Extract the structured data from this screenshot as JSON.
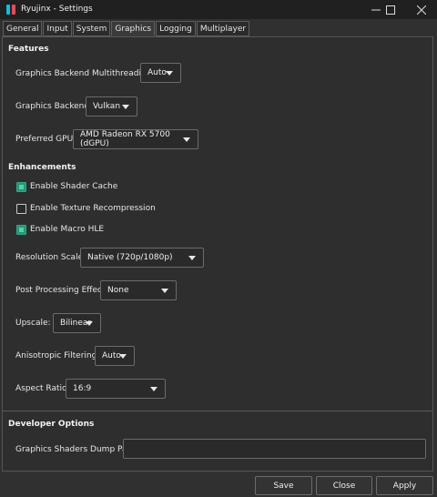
{
  "window": {
    "title": "Ryujinx - Settings"
  },
  "tabs": [
    {
      "label": "General"
    },
    {
      "label": "Input"
    },
    {
      "label": "System"
    },
    {
      "label": "Graphics",
      "active": true
    },
    {
      "label": "Logging"
    },
    {
      "label": "Multiplayer"
    }
  ],
  "features": {
    "heading": "Features",
    "multithreading": {
      "label": "Graphics Backend Multithreading:",
      "value": "Auto"
    },
    "backend": {
      "label": "Graphics Backend:",
      "value": "Vulkan"
    },
    "gpu": {
      "label": "Preferred GPU:",
      "value": "AMD Radeon RX 5700 (dGPU)"
    }
  },
  "enhancements": {
    "heading": "Enhancements",
    "shader_cache": {
      "label": "Enable Shader Cache",
      "checked": true
    },
    "texture_recompression": {
      "label": "Enable Texture Recompression",
      "checked": false
    },
    "macro_hle": {
      "label": "Enable Macro HLE",
      "checked": true
    },
    "resolution_scale": {
      "label": "Resolution Scale:",
      "value": "Native (720p/1080p)"
    },
    "post_processing": {
      "label": "Post Processing Effect:",
      "value": "None"
    },
    "upscale": {
      "label": "Upscale:",
      "value": "Bilinear"
    },
    "anisotropic": {
      "label": "Anisotropic Filtering:",
      "value": "Auto"
    },
    "aspect_ratio": {
      "label": "Aspect Ratio:",
      "value": "16:9"
    }
  },
  "developer": {
    "heading": "Developer Options",
    "shader_dump": {
      "label": "Graphics Shaders Dump Path:",
      "value": ""
    }
  },
  "footer": {
    "save": "Save",
    "close": "Close",
    "apply": "Apply"
  },
  "colors": {
    "accent": "#1f9a77",
    "background": "#303030",
    "titlebar": "#202020"
  }
}
